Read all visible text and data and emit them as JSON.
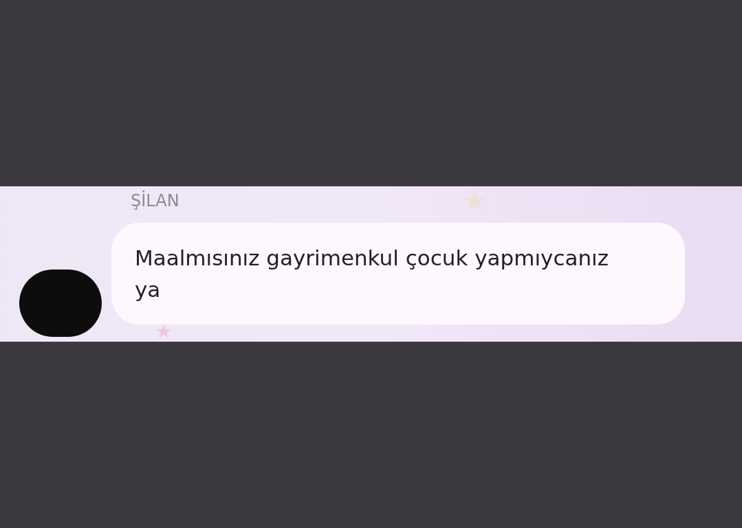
{
  "message": {
    "sender": "ŞİLAN",
    "text": "Maalmısınız gayrimenkul çocuk yapmıycanız ya"
  }
}
